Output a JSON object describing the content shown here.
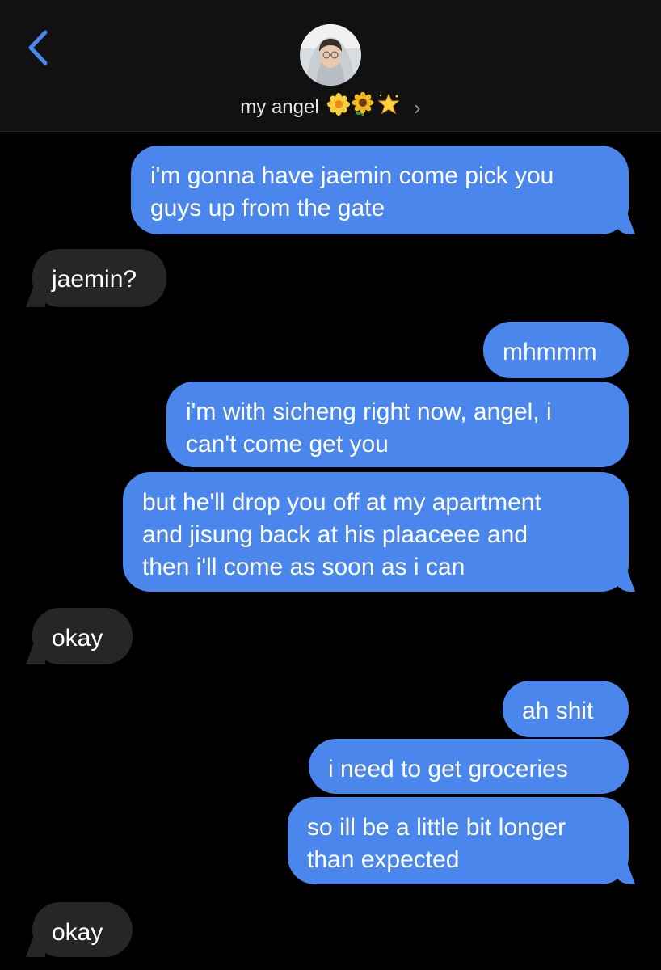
{
  "header": {
    "contact_name": "my angel",
    "contact_emoji": "🌼🌻🌟",
    "chevron": "›",
    "back_icon": "chevron-left-icon",
    "accent_color": "#4b86ec"
  },
  "messages": [
    {
      "side": "sent",
      "lines": [
        "i'm gonna have jaemin come pick you",
        "guys up from the gate"
      ]
    },
    {
      "side": "received",
      "lines": [
        "jaemin?"
      ]
    },
    {
      "side": "sent",
      "lines": [
        "mhmmm"
      ]
    },
    {
      "side": "sent",
      "lines": [
        "i'm with sicheng right now, angel, i",
        "can't come get you"
      ]
    },
    {
      "side": "sent",
      "lines": [
        "but he'll drop you off at my apartment",
        "and jisung back at his plaaceee and",
        "then i'll come as soon as i can"
      ]
    },
    {
      "side": "received",
      "lines": [
        "okay"
      ]
    },
    {
      "side": "sent",
      "lines": [
        "ah shit"
      ]
    },
    {
      "side": "sent",
      "lines": [
        "i need to get groceries"
      ]
    },
    {
      "side": "sent",
      "lines": [
        "so ill be a little bit longer",
        "than expected"
      ]
    },
    {
      "side": "received",
      "lines": [
        "okay"
      ]
    }
  ],
  "colors": {
    "sent_bubble": "#4b86ec",
    "received_bubble": "#262628",
    "background": "#000000",
    "header_background": "#111111"
  }
}
